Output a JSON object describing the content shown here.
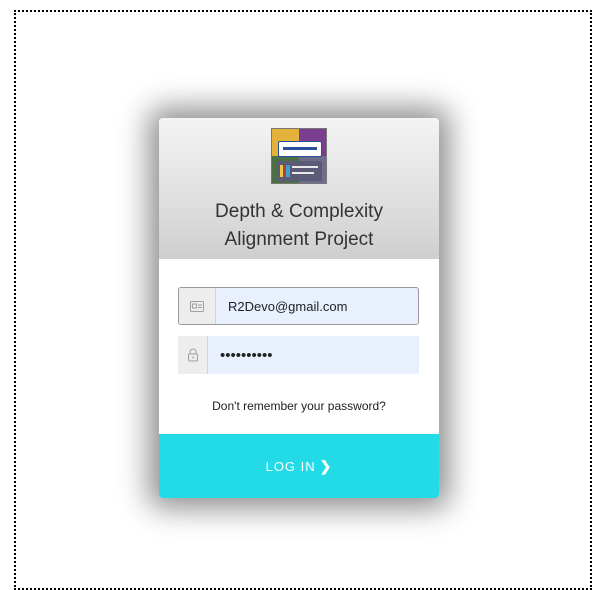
{
  "app": {
    "title_line1": "Depth & Complexity",
    "title_line2": "Alignment Project"
  },
  "form": {
    "email_value": "R2Devo@gmail.com",
    "password_value": "••••••••••",
    "forgot_label": "Don't remember your password?",
    "login_label": "LOG IN",
    "login_chevron": "❯"
  },
  "icons": {
    "email": "id-card-icon",
    "password": "lock-icon"
  },
  "colors": {
    "accent": "#22dbe6",
    "input_bg": "#e8f0fe"
  }
}
